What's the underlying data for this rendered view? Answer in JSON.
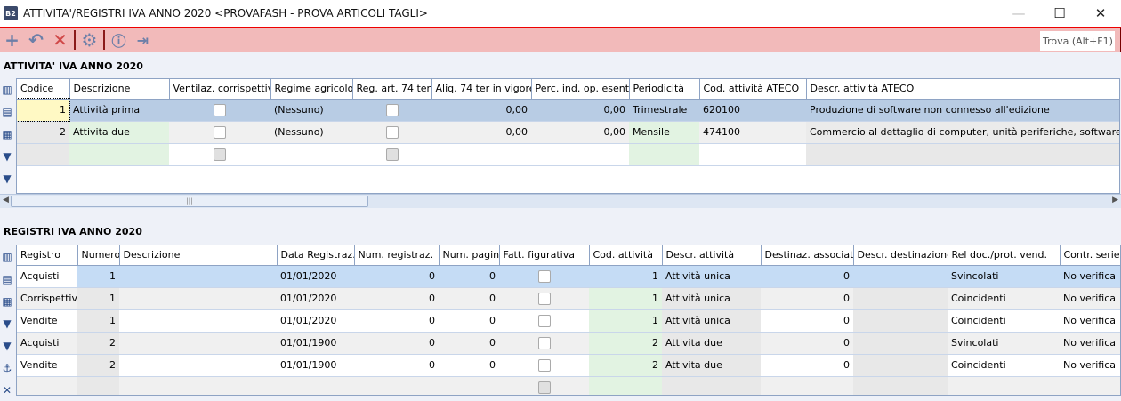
{
  "window": {
    "title": "ATTIVITA'/REGISTRI IVA ANNO 2020 <PROVAFASH - PROVA ARTICOLI TAGLI>",
    "app_icon": "B2",
    "minimize": "—",
    "maximize": "☐",
    "close": "✕"
  },
  "toolbar": {
    "search_placeholder": "Trova (Alt+F1)"
  },
  "attivita": {
    "title": "ATTIVITA' IVA ANNO 2020",
    "columns": [
      "Codice",
      "Descrizione",
      "Ventilaz. corrispettivi",
      "Regime agricolo",
      "Reg. art. 74 ter",
      "Aliq. 74 ter in vigore",
      "Perc. ind. op. esenti",
      "Periodicità",
      "Cod. attività ATECO",
      "Descr. attività ATECO"
    ],
    "rows": [
      [
        "1",
        "Attività prima",
        false,
        "(Nessuno)",
        false,
        "0,00",
        "0,00",
        "Trimestrale",
        "620100",
        "Produzione di software non connesso all'edizione"
      ],
      [
        "2",
        "Attivita due",
        false,
        "(Nessuno)",
        false,
        "0,00",
        "0,00",
        "Mensile",
        "474100",
        "Commercio al dettaglio di computer, unità periferiche, software e attrezzature per ufficio"
      ],
      [
        "",
        "",
        null,
        "",
        null,
        "",
        "",
        "",
        "",
        ""
      ]
    ]
  },
  "registri": {
    "title": "REGISTRI IVA ANNO 2020",
    "columns": [
      "Registro",
      "Numero",
      "Descrizione",
      "Data Registraz.",
      "Num. registraz.",
      "Num. pagina",
      "Fatt. figurativa",
      "Cod. attività",
      "Descr. attività",
      "Destinaz. associata",
      "Descr. destinazione",
      "Rel doc./prot. vend.",
      "Contr. serie prot."
    ],
    "rows": [
      [
        "Acquisti",
        "1",
        "",
        "01/01/2020",
        "0",
        "0",
        false,
        "1",
        "Attività unica",
        "0",
        "",
        "Svincolati",
        "No verifica"
      ],
      [
        "Corrispettivi",
        "1",
        "",
        "01/01/2020",
        "0",
        "0",
        false,
        "1",
        "Attività unica",
        "0",
        "",
        "Coincidenti",
        "No verifica"
      ],
      [
        "Vendite",
        "1",
        "",
        "01/01/2020",
        "0",
        "0",
        false,
        "1",
        "Attività unica",
        "0",
        "",
        "Coincidenti",
        "No verifica"
      ],
      [
        "Acquisti",
        "2",
        "",
        "01/01/1900",
        "0",
        "0",
        false,
        "2",
        "Attivita due",
        "0",
        "",
        "Svincolati",
        "No verifica"
      ],
      [
        "Vendite",
        "2",
        "",
        "01/01/1900",
        "0",
        "0",
        false,
        "2",
        "Attivita due",
        "0",
        "",
        "Coincidenti",
        "No verifica"
      ],
      [
        "",
        "",
        "",
        "",
        "",
        "",
        null,
        "",
        "",
        "",
        "",
        "",
        ""
      ]
    ]
  }
}
